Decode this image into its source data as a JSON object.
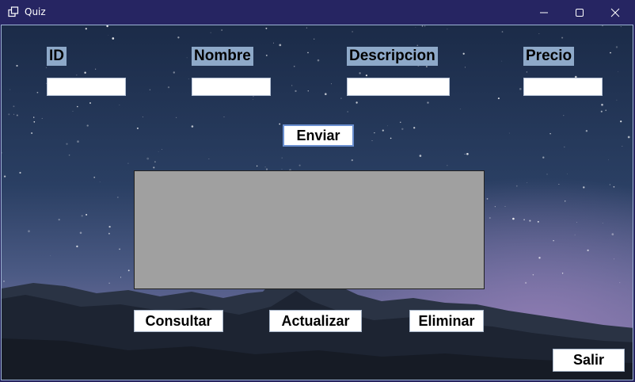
{
  "window": {
    "title": "Quiz",
    "app_icon": "window-icon",
    "controls": [
      "minimize-icon",
      "maximize-icon",
      "close-icon"
    ]
  },
  "form": {
    "fields": [
      {
        "label": "ID",
        "value": ""
      },
      {
        "label": "Nombre",
        "value": ""
      },
      {
        "label": "Descripcion",
        "value": ""
      },
      {
        "label": "Precio",
        "value": ""
      }
    ],
    "submit_label": "Enviar"
  },
  "grid": {
    "rows": []
  },
  "actions": {
    "consultar": "Consultar",
    "actualizar": "Actualizar",
    "eliminar": "Eliminar",
    "salir": "Salir"
  },
  "colors": {
    "titlebar": "#262562",
    "label_bg": "#8ea9c9",
    "grid_bg": "#a0a0a0",
    "accent": "#6a8fd0"
  }
}
